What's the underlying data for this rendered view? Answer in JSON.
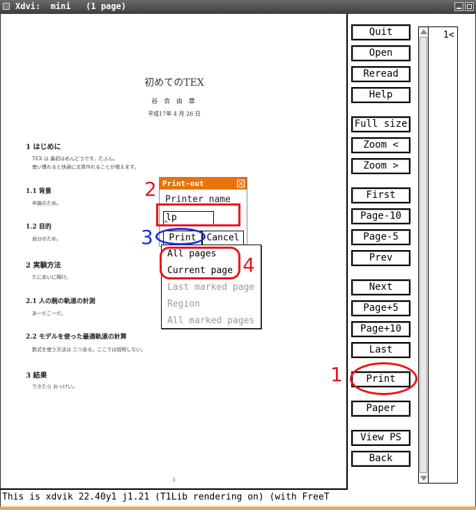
{
  "window": {
    "title": "Xdvi:  mini   (1 page)"
  },
  "document": {
    "title": "初めてのTEX",
    "author": "谷 合 由 章",
    "date": "平成17年 4 月 26 日",
    "page_number": "1",
    "sections": [
      {
        "heading": "1   はじめに",
        "lines": [
          "TEX は 最初はめんどうです。たぶん。",
          "使い慣れると快適に文章作れることが増えます。"
        ]
      },
      {
        "heading": "1.1   背景",
        "lines": [
          "卒論のため。"
        ]
      },
      {
        "heading": "1.2   目的",
        "lines": [
          "自分のため。"
        ]
      },
      {
        "heading": "2   実験方法",
        "lines": [
          "たにあいに聞け。"
        ]
      },
      {
        "heading": "2.1   人の腕の軌道の計測",
        "lines": [
          "あーだこーだ。"
        ]
      },
      {
        "heading": "2.2   モデルを使った最適軌道の計算",
        "lines": [
          "数式を使う方法は 二つある。ここでは説明しない。"
        ]
      },
      {
        "heading": "3   結果",
        "lines": [
          "できたら おっけい。"
        ]
      }
    ]
  },
  "status_line": "This is xdvik 22.40y1 j1.21   (T1Lib rendering on) (with FreeT",
  "controls": {
    "buttons": [
      "Quit",
      "Open",
      "Reread",
      "Help",
      "Full size",
      "Zoom <",
      "Zoom >",
      "First",
      "Page-10",
      "Page-5",
      "Prev",
      "Next",
      "Page+5",
      "Page+10",
      "Last",
      "Print",
      "Paper",
      "View PS",
      "Back"
    ]
  },
  "page_list": {
    "entries": [
      "1<"
    ]
  },
  "print_dialog": {
    "title": "Print-out",
    "printer_label": "Printer name",
    "printer_value": "lp",
    "print_button": "Print",
    "cancel_button": "Cancel",
    "menu": {
      "items": [
        {
          "label": "All pages",
          "enabled": true
        },
        {
          "label": "Current page",
          "enabled": true
        },
        {
          "label": "Last marked page",
          "enabled": false
        },
        {
          "label": "Region",
          "enabled": false
        },
        {
          "label": "All marked pages",
          "enabled": false
        }
      ]
    }
  },
  "annotations": {
    "step1": "1",
    "step2": "2",
    "step3": "3",
    "step4": "4",
    "red": "#e8141c",
    "blue": "#1a2fe0"
  }
}
